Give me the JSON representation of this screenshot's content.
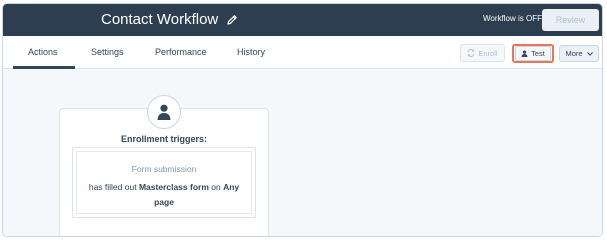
{
  "header": {
    "title": "Contact Workflow",
    "workflow_status": "Workflow is OFF",
    "review_label": "Review"
  },
  "tabs": [
    {
      "label": "Actions",
      "active": true
    },
    {
      "label": "Settings",
      "active": false
    },
    {
      "label": "Performance",
      "active": false
    },
    {
      "label": "History",
      "active": false
    }
  ],
  "toolbar": {
    "enroll_label": "Enroll",
    "test_label": "Test",
    "more_label": "More"
  },
  "trigger_card": {
    "heading": "Enrollment triggers:",
    "filter_type": "Form submission",
    "desc_prefix": "has filled out",
    "form_name": "Masterclass form",
    "desc_middle": "on",
    "page_name": "Any page"
  },
  "colors": {
    "header_bg": "#2d3e50",
    "highlight": "#e8775a",
    "canvas_bg": "#f5f8fa"
  }
}
